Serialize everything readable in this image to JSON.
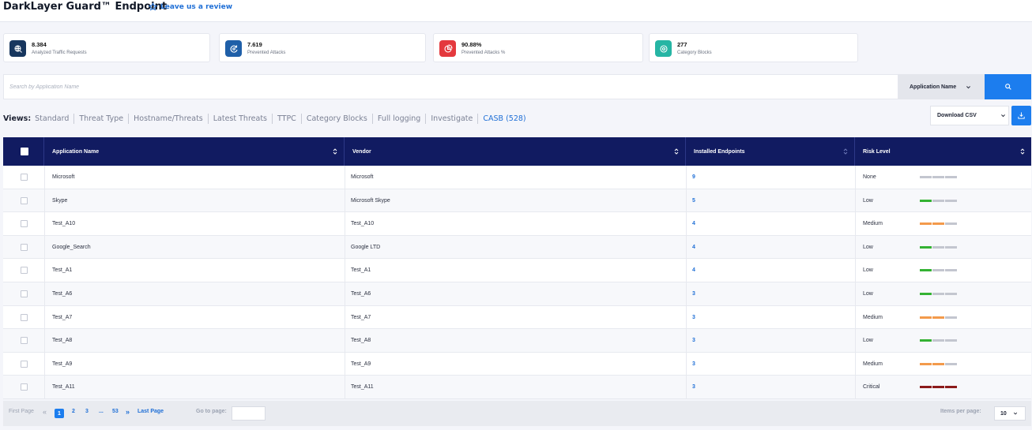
{
  "header": {
    "title": "DarkLayer Guard™ Endpoint",
    "review_label": "Leave us a review"
  },
  "stats": [
    {
      "value": "8.384",
      "label": "Analyzed Traffic Requests",
      "icon": "globe-search-icon",
      "color": "#17365e"
    },
    {
      "value": "7.619",
      "label": "Prevented Attacks",
      "icon": "shield-refresh-icon",
      "color": "#1f5fa8"
    },
    {
      "value": "90.88%",
      "label": "Prevented Attacks %",
      "icon": "pie-chart-icon",
      "color": "#e4393e"
    },
    {
      "value": "277",
      "label": "Category Blocks",
      "icon": "block-target-icon",
      "color": "#26b5a4"
    }
  ],
  "search": {
    "placeholder": "Search by Application Name",
    "filter_label": "Application Name"
  },
  "views": {
    "label": "Views:",
    "items": [
      "Standard",
      "Threat Type",
      "Hostname/Threats",
      "Latest Threats",
      "TTPC",
      "Category Blocks",
      "Full logging",
      "Investigate",
      "CASB (528)"
    ],
    "active": "CASB (528)"
  },
  "download": {
    "label": "Download CSV"
  },
  "table": {
    "columns": [
      "Application Name",
      "Vendor",
      "Installed Endpoints",
      "Risk Level"
    ],
    "rows": [
      {
        "app": "Microsoft",
        "vendor": "Microsoft",
        "endpoints": "9",
        "risk": "None",
        "level": 0,
        "color": "#c3c6cf"
      },
      {
        "app": "Skype",
        "vendor": "Microsoft Skype",
        "endpoints": "5",
        "risk": "Low",
        "level": 1,
        "color": "#34b233"
      },
      {
        "app": "Test_A10",
        "vendor": "Test_A10",
        "endpoints": "4",
        "risk": "Medium",
        "level": 2,
        "color": "#f39a4b"
      },
      {
        "app": "Google_Search",
        "vendor": "Google LTD",
        "endpoints": "4",
        "risk": "Low",
        "level": 1,
        "color": "#34b233"
      },
      {
        "app": "Test_A1",
        "vendor": "Test_A1",
        "endpoints": "4",
        "risk": "Low",
        "level": 1,
        "color": "#34b233"
      },
      {
        "app": "Test_A6",
        "vendor": "Test_A6",
        "endpoints": "3",
        "risk": "Low",
        "level": 1,
        "color": "#34b233"
      },
      {
        "app": "Test_A7",
        "vendor": "Test_A7",
        "endpoints": "3",
        "risk": "Medium",
        "level": 2,
        "color": "#f39a4b"
      },
      {
        "app": "Test_A8",
        "vendor": "Test_A8",
        "endpoints": "3",
        "risk": "Low",
        "level": 1,
        "color": "#34b233"
      },
      {
        "app": "Test_A9",
        "vendor": "Test_A9",
        "endpoints": "3",
        "risk": "Medium",
        "level": 2,
        "color": "#f39a4b"
      },
      {
        "app": "Test_A11",
        "vendor": "Test_A11",
        "endpoints": "3",
        "risk": "Critical",
        "level": 3,
        "color": "#8b1a1a"
      }
    ]
  },
  "pagination": {
    "first": "First Page",
    "prev": "«",
    "pages": [
      "1",
      "2",
      "3",
      "...",
      "53"
    ],
    "current": "1",
    "next": "»",
    "last": "Last Page",
    "goto_label": "Go to page:",
    "items_label": "Items per page:",
    "items_value": "10"
  }
}
